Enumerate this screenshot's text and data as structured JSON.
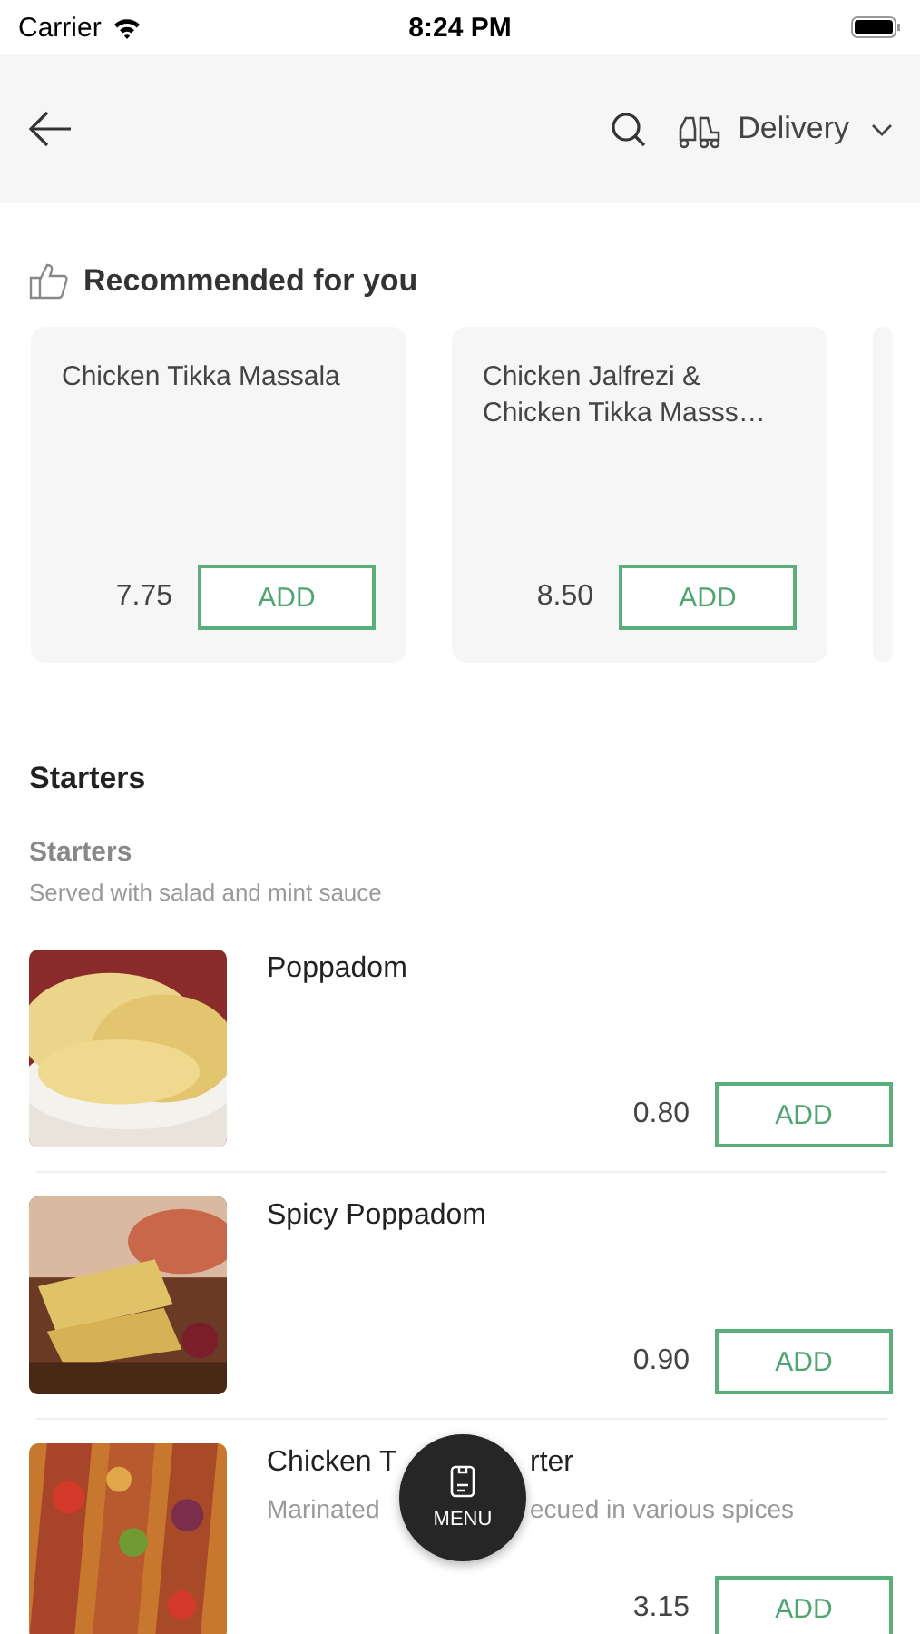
{
  "status_bar": {
    "carrier": "Carrier",
    "time": "8:24 PM"
  },
  "header": {
    "delivery_mode": "Delivery"
  },
  "recommended": {
    "title": "Recommended for you",
    "items": [
      {
        "name": "Chicken Tikka Massala",
        "price": "7.75",
        "button": "ADD"
      },
      {
        "name": "Chicken Jalfrezi & Chicken Tikka Masss…",
        "price": "8.50",
        "button": "ADD"
      }
    ]
  },
  "section": {
    "title": "Starters",
    "subtitle": "Starters",
    "description": "Served with salad and mint sauce",
    "items": [
      {
        "name_parts": [
          "Poppadom"
        ],
        "price": "0.80",
        "button": "ADD"
      },
      {
        "name_parts": [
          "Spicy Poppadom"
        ],
        "price": "0.90",
        "button": "ADD"
      },
      {
        "name_parts": [
          "Chicken T",
          "rter"
        ],
        "description_parts": [
          "Marinated",
          "ecued in various spices"
        ],
        "price": "3.15",
        "button": "ADD"
      }
    ]
  },
  "menu_button": {
    "label": "MENU"
  }
}
